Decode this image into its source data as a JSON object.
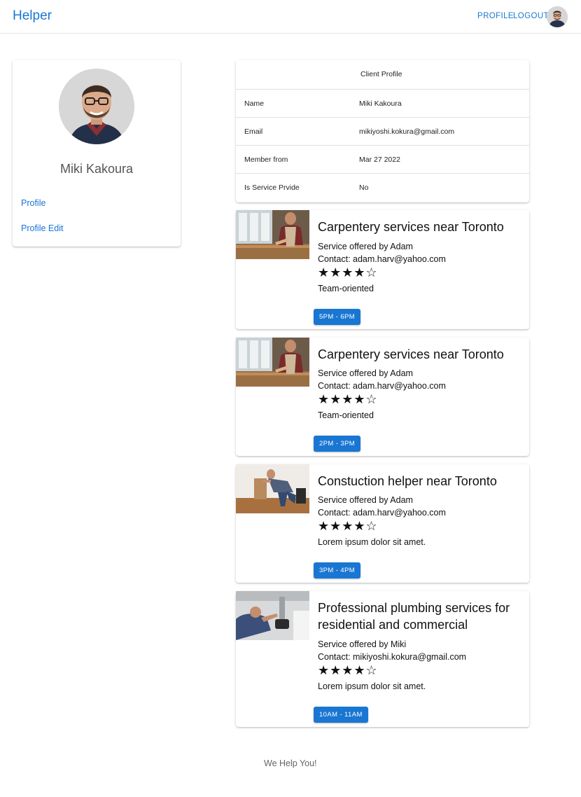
{
  "app": {
    "brand": "Helper"
  },
  "nav": {
    "profile_label": "PROFILE",
    "logout_label": "LOGOUT"
  },
  "sidebar": {
    "name": "Miki Kakoura",
    "links": [
      "Profile",
      "Profile Edit"
    ]
  },
  "client_profile": {
    "title": "Client Profile",
    "rows": [
      {
        "key": "Name",
        "value": "Miki Kakoura"
      },
      {
        "key": "Email",
        "value": "mikiyoshi.kokura@gmail.com"
      },
      {
        "key": "Member from",
        "value": "Mar 27 2022"
      },
      {
        "key": "Is Service Prvide",
        "value": "No"
      }
    ]
  },
  "services": [
    {
      "title": "Carpentery services near Toronto",
      "offered_by": "Service offered by Adam",
      "contact": "Contact: adam.harv@yahoo.com",
      "rating": 4,
      "rating_max": 5,
      "description": "Team-oriented",
      "time": "5PM - 6PM",
      "image": "carpenter-photo"
    },
    {
      "title": "Carpentery services near Toronto",
      "offered_by": "Service offered by Adam",
      "contact": "Contact: adam.harv@yahoo.com",
      "rating": 4,
      "rating_max": 5,
      "description": "Team-oriented",
      "time": "2PM - 3PM",
      "image": "carpenter-photo"
    },
    {
      "title": "Constuction helper near Toronto",
      "offered_by": "Service offered by Adam",
      "contact": "Contact: adam.harv@yahoo.com",
      "rating": 4,
      "rating_max": 5,
      "description": "Lorem ipsum dolor sit amet.",
      "time": "3PM - 4PM",
      "image": "construction-worker-photo"
    },
    {
      "title": "Professional plumbing services for residential and commercial",
      "offered_by": "Service offered by Miki",
      "contact": "Contact: mikiyoshi.kokura@gmail.com",
      "rating": 4,
      "rating_max": 5,
      "description": "Lorem ipsum dolor sit amet.",
      "time": "10AM - 11AM",
      "image": "plumber-photo"
    }
  ],
  "footer": {
    "text": "We Help You!"
  },
  "colors": {
    "primary": "#1976d2",
    "divider": "#e0e0e0"
  }
}
